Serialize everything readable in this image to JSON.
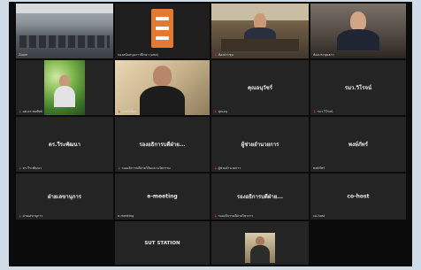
{
  "participants": [
    {
      "id": "t1",
      "label": "Zoom",
      "name": "",
      "video": "classroom"
    },
    {
      "id": "t2",
      "label": "กองสนับสนุนการศึกษา (มทส)",
      "name": "",
      "video": "logo"
    },
    {
      "id": "t3",
      "label": "ห้องประชุม",
      "name": "",
      "video": "meeting-room",
      "active": true
    },
    {
      "id": "t4",
      "label": "ห้องประชุมสภา",
      "name": "",
      "video": "speaker"
    },
    {
      "id": "t5",
      "label": "ผศ.ดร.ชยพัทธ์",
      "name": "",
      "video": "plant-person"
    },
    {
      "id": "t6",
      "label": "นายวิเชียร",
      "name": "",
      "video": "person"
    },
    {
      "id": "t7",
      "label": "คุณอนุ",
      "name": "คุณอนุวัชร์",
      "video": ""
    },
    {
      "id": "t8",
      "label": "รมว.วิโรจน์",
      "name": "รมว.วิโรจน์",
      "video": ""
    },
    {
      "id": "t9",
      "label": "ดร.วีระพัฒนา",
      "name": "ดร.วีระพัฒนา",
      "video": ""
    },
    {
      "id": "t10",
      "label": "รองอธิการบดีฝ่ายวิจัยและนวัตกรรม",
      "name": "รองอธิการบดีฝ่าย...",
      "video": ""
    },
    {
      "id": "t11",
      "label": "ผู้ช่วยอำนวยการ",
      "name": "ผู้ช่วยอำนวยการ",
      "video": ""
    },
    {
      "id": "t12",
      "label": "พงษ์ภัทร์",
      "name": "พงษ์ภัทร์",
      "video": ""
    },
    {
      "id": "t13",
      "label": "ฝ่ายเลขานุการ",
      "name": "ฝ่ายเลขานุการ",
      "video": ""
    },
    {
      "id": "t14",
      "label": "e-meeting",
      "name": "e-meeting",
      "video": ""
    },
    {
      "id": "t15",
      "label": "รองอธิการบดีฝ่ายวิชาการ",
      "name": "รองอธิการบดีฝ่าย...",
      "video": ""
    },
    {
      "id": "t16",
      "label": "co-host",
      "name": "co-host",
      "video": ""
    },
    {
      "id": "t17",
      "label": "",
      "name": "SUT STATION",
      "video": ""
    },
    {
      "id": "t18",
      "label": "",
      "name": "",
      "video": "small-person"
    }
  ]
}
